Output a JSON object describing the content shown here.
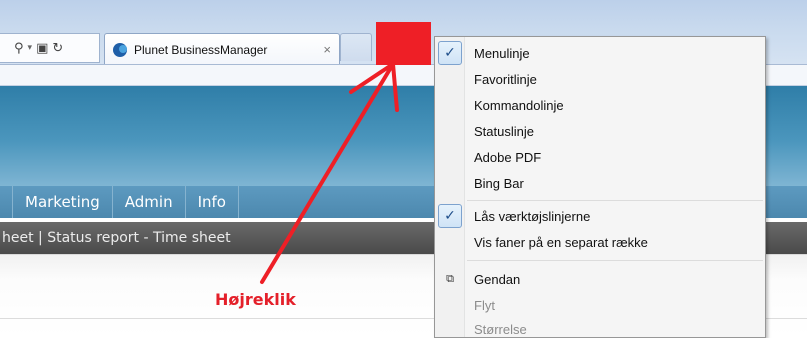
{
  "browser": {
    "tab_title": "Plunet BusinessManager",
    "tab_close": "×",
    "tab_icon": "plunet-logo-icon",
    "toolbar_glyphs": {
      "search": "⚲",
      "dropdown": "▾",
      "compat": "▣",
      "refresh": "↻"
    }
  },
  "app": {
    "nav_items": [
      "Marketing",
      "Admin",
      "Info"
    ],
    "sub_nav": "heet | Status report - Time sheet",
    "colors": {
      "header": "#4b96bd",
      "nav": "#5d9ac0",
      "sub_nav": "#5a5a5a"
    }
  },
  "context_menu": {
    "items": [
      {
        "label": "Menulinje",
        "checked": true,
        "icon": "check-icon"
      },
      {
        "label": "Favoritlinje",
        "checked": false
      },
      {
        "label": "Kommandolinje",
        "checked": false
      },
      {
        "label": "Statuslinje",
        "checked": false
      },
      {
        "label": "Adobe PDF",
        "checked": false
      },
      {
        "label": "Bing Bar",
        "checked": false
      },
      {
        "label": "Lås værktøjslinjerne",
        "checked": true,
        "icon": "check-icon"
      },
      {
        "label": "Vis faner på en separat række",
        "checked": false
      },
      {
        "label": "Gendan",
        "icon": "restore-window-icon"
      },
      {
        "label": "Flyt",
        "disabled": true
      },
      {
        "label": "Størrelse",
        "disabled": true
      }
    ],
    "check_glyph": "✓",
    "restore_glyph": "⧉"
  },
  "annotation": {
    "label": "Højreklik",
    "color": "#e4202a",
    "marker_color": "#ee1f26"
  }
}
